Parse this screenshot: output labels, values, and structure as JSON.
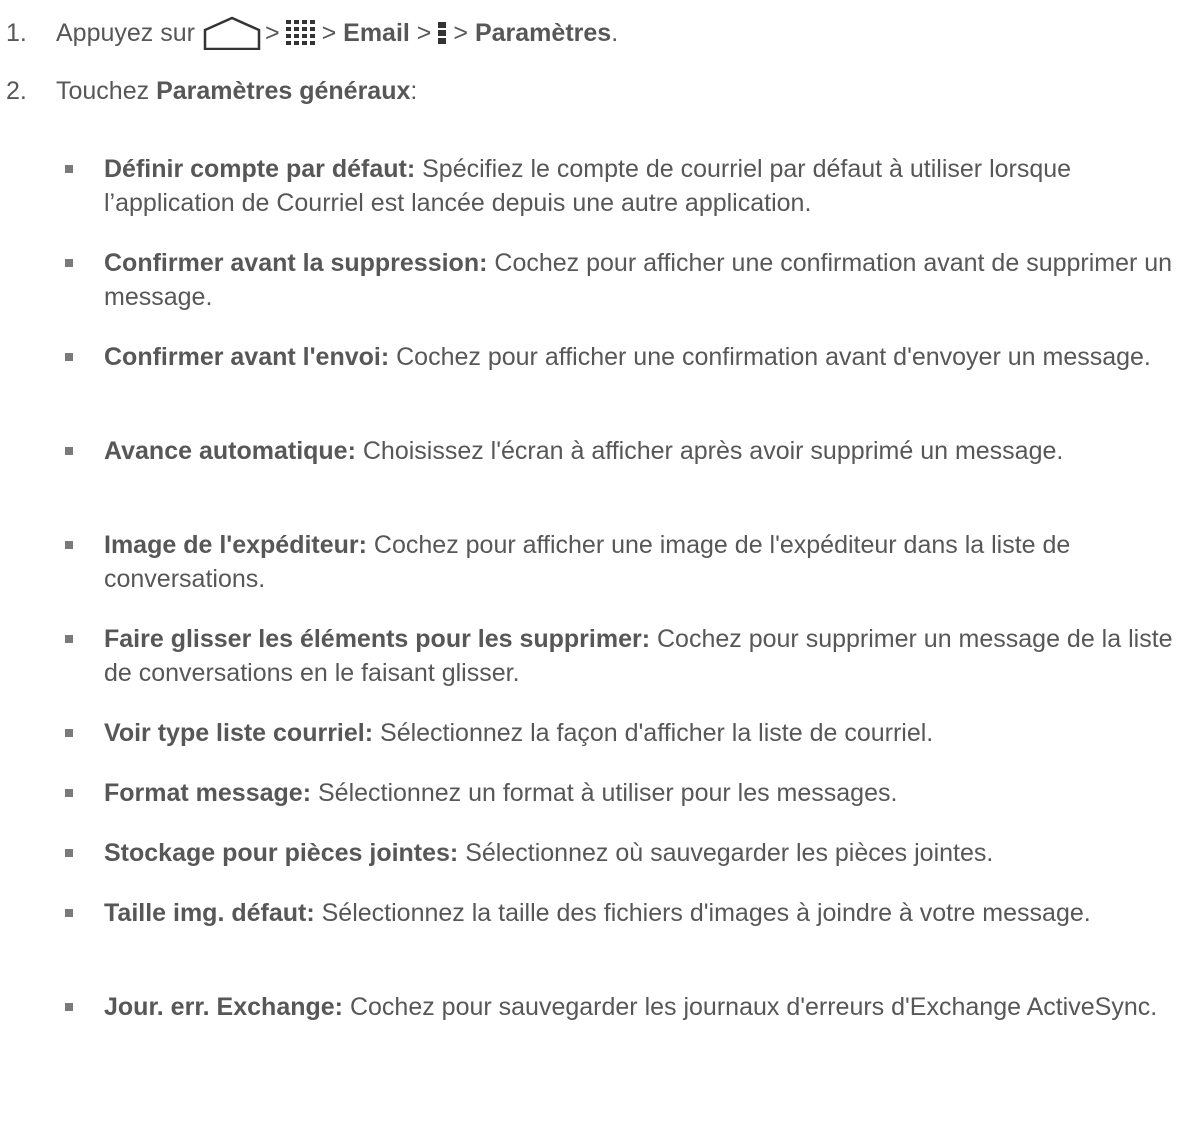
{
  "step1": {
    "number": "1.",
    "prefix": "Appuyez sur",
    "separators": [
      ">",
      ">",
      ">",
      ">"
    ],
    "email": "Email",
    "settings": "Paramètres",
    "end": ".",
    "icons": [
      "home-icon",
      "apps-grid-icon",
      "menu-icon"
    ]
  },
  "step2": {
    "number": "2.",
    "prefix": "Touchez",
    "bold": "Paramètres généraux",
    "end": ":"
  },
  "items": [
    {
      "term": "Définir compte par défaut:",
      "desc": "Spécifiez le compte de courriel par défaut à utiliser lorsque l’application de Courriel est lancée depuis une autre application."
    },
    {
      "term": "Confirmer avant la suppression:",
      "desc": "Cochez pour afficher une confirmation avant de supprimer un message."
    },
    {
      "term": "Confirmer avant l'envoi:",
      "desc": "Cochez pour afficher une confirmation avant d'envoyer un message."
    },
    {
      "term": "Avance automatique:",
      "desc": "Choisissez l'écran à afficher après avoir supprimé un message."
    },
    {
      "term": "Image de l'expéditeur:",
      "desc": "Cochez pour afficher une image de l'expéditeur dans la liste de conversations."
    },
    {
      "term": "Faire glisser les éléments pour les supprimer:",
      "desc": "Cochez pour supprimer un message de la liste de conversations en le faisant glisser."
    },
    {
      "term": "Voir type liste courriel:",
      "desc": "Sélectionnez la façon d'afficher la liste de courriel."
    },
    {
      "term": "Format message:",
      "desc": "Sélectionnez un format à utiliser pour les messages."
    },
    {
      "term": "Stockage pour pièces jointes:",
      "desc": "Sélectionnez où sauvegarder les pièces jointes."
    },
    {
      "term": "Taille img. défaut:",
      "desc": "Sélectionnez la taille des fichiers d'images à joindre à votre message."
    },
    {
      "term": "Jour. err. Exchange:",
      "desc": "Cochez pour sauvegarder les journaux d'erreurs d'Exchange ActiveSync."
    }
  ]
}
